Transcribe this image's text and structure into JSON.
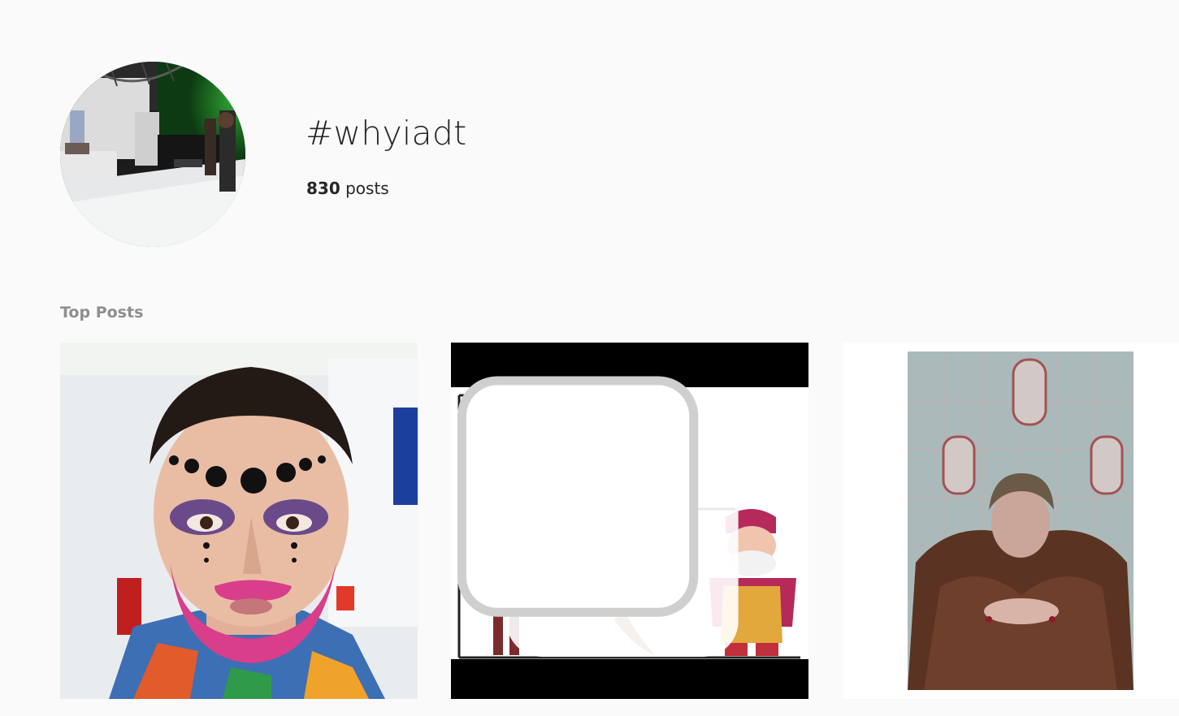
{
  "header": {
    "hashtag": "#whyiadt",
    "post_count": "830",
    "post_count_label": "posts"
  },
  "top_posts": {
    "label": "Top Posts",
    "items": [
      {
        "kind": "photo",
        "subject": "portrait with face makeup"
      },
      {
        "kind": "carousel",
        "subject": "character lineup illustration",
        "icon": "multiple-images-icon"
      },
      {
        "kind": "photo",
        "subject": "portrait in fur coat against tiled wall"
      }
    ]
  },
  "colors": {
    "background": "#fafafa",
    "text": "#262626",
    "secondary_text": "#8e8e8e"
  }
}
